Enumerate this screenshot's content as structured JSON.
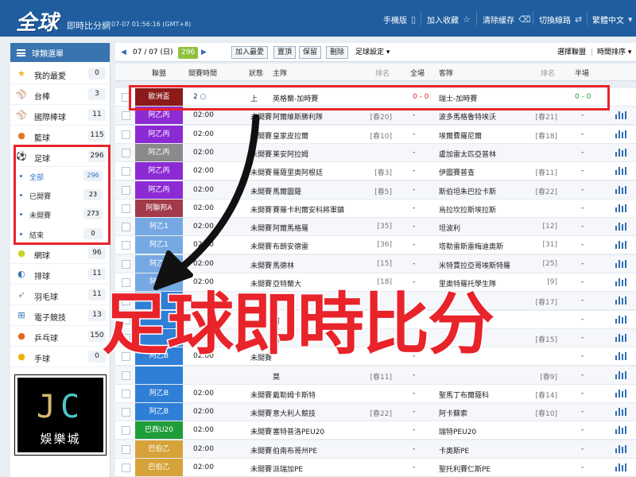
{
  "header": {
    "logo": "全球",
    "subtitle": "即時比分網",
    "clock": "07-07 01:56:16 (GMT+8)",
    "nav": {
      "mobile": "手機版",
      "bookmark": "加入收藏",
      "clear_cache": "清除緩存",
      "switch_line": "切換線路",
      "language": "繁體中文"
    }
  },
  "sidebar": {
    "title": "球類選單",
    "items": [
      {
        "label": "我的最愛",
        "count": "0",
        "icon": "star-icon"
      },
      {
        "label": "台棒",
        "count": "3",
        "icon": "baseball-icon"
      },
      {
        "label": "國際棒球",
        "count": "11",
        "icon": "baseball-icon"
      },
      {
        "label": "籃球",
        "count": "115",
        "icon": "basketball-icon"
      },
      {
        "label": "足球",
        "count": "296",
        "icon": "soccer-icon"
      },
      {
        "label": "網球",
        "count": "96",
        "icon": "tennis-icon"
      },
      {
        "label": "排球",
        "count": "11",
        "icon": "volleyball-icon"
      },
      {
        "label": "羽毛球",
        "count": "11",
        "icon": "badminton-icon"
      },
      {
        "label": "電子競技",
        "count": "13",
        "icon": "gamepad-icon"
      },
      {
        "label": "乒乓球",
        "count": "150",
        "icon": "pingpong-icon"
      },
      {
        "label": "手球",
        "count": "0",
        "icon": "handball-icon"
      }
    ],
    "soccer_sub": [
      {
        "label": "全部",
        "count": "296"
      },
      {
        "label": "已開賽",
        "count": "23"
      },
      {
        "label": "未開賽",
        "count": "273"
      },
      {
        "label": "結束",
        "count": "0"
      }
    ]
  },
  "toolbar": {
    "date": "07 / 07 (日)",
    "count": "296",
    "add_fav": "加入最愛",
    "top": "置頂",
    "keep": "保留",
    "delete": "刪除",
    "settings": "足球設定",
    "select_league": "選擇聯盟",
    "time_sort": "時間排序"
  },
  "table": {
    "headers": {
      "league": "聯盟",
      "start_time": "開賽時間",
      "status": "狀態",
      "home": "主隊",
      "home_rank": "排名",
      "full": "全場",
      "away": "客隊",
      "away_rank": "排名",
      "half": "半場"
    },
    "rows": [
      {
        "league": "歐洲盃",
        "color": "#8b1a1a",
        "time": "2",
        "state": "上",
        "home": "英格蘭-加時賽",
        "hrank": "",
        "full": "0 - 0",
        "away": "瑞士-加時賽",
        "arank": "",
        "half": "0 - 0",
        "live": true
      },
      {
        "league": "阿乙丙",
        "color": "#8c2bd4",
        "time": "02:00",
        "state": "未開賽",
        "home": "阿爾維斯勝利隊",
        "hrank": "[春20]",
        "full": "-",
        "away": "波多馬格魯特埃沃",
        "arank": "[春21]",
        "half": "-"
      },
      {
        "league": "阿乙丙",
        "color": "#8c2bd4",
        "time": "02:00",
        "state": "未開賽",
        "home": "皇家皮拉爾",
        "hrank": "[春10]",
        "full": "-",
        "away": "埃爾費羅尼爾",
        "arank": "[春18]",
        "half": "-"
      },
      {
        "league": "阿乙丙",
        "color": "#8a8a8a",
        "time": "02:00",
        "state": "未開賽",
        "home": "莱安阿拉姆",
        "hrank": "",
        "full": "-",
        "away": "盧加雷太匹亞普林",
        "arank": "",
        "half": "-"
      },
      {
        "league": "阿乙丙",
        "color": "#8c2bd4",
        "time": "02:00",
        "state": "未開賽",
        "home": "羅薩里奧阿根廷",
        "hrank": "[春3]",
        "full": "-",
        "away": "伊圖賽普查",
        "arank": "[春11]",
        "half": "-"
      },
      {
        "league": "阿乙丙",
        "color": "#8c2bd4",
        "time": "02:00",
        "state": "未開賽",
        "home": "馬爾圖薩",
        "hrank": "[春5]",
        "full": "-",
        "away": "斯伯坦朱巴拉卡斯",
        "arank": "[春22]",
        "half": "-"
      },
      {
        "league": "阿聯邦A",
        "color": "#a33a4a",
        "time": "02:00",
        "state": "未開賽",
        "home": "賽羅卡利爾安科將軍鎮",
        "hrank": "",
        "full": "-",
        "away": "烏拉坎拉斯埃拉斯",
        "arank": "",
        "half": "-"
      },
      {
        "league": "阿乙1",
        "color": "#76a9e3",
        "time": "02:00",
        "state": "未開賽",
        "home": "阿爾馬格羅",
        "hrank": "[35]",
        "full": "-",
        "away": "坦波利",
        "arank": "[12]",
        "half": "-"
      },
      {
        "league": "阿乙1",
        "color": "#76a9e3",
        "time": "02:00",
        "state": "未開賽",
        "home": "布朗安德雷",
        "hrank": "[36]",
        "full": "-",
        "away": "塔勒雷斯雷梅迪奧斯",
        "arank": "[31]",
        "half": "-"
      },
      {
        "league": "阿乙1",
        "color": "#76a9e3",
        "time": "02:00",
        "state": "未開賽",
        "home": "馬德林",
        "hrank": "[15]",
        "full": "-",
        "away": "米特賈拉亞哥埃斯特羅",
        "arank": "[25]",
        "half": "-"
      },
      {
        "league": "阿乙1",
        "color": "#76a9e3",
        "time": "02:00",
        "state": "未開賽",
        "home": "亞特蘭大",
        "hrank": "[18]",
        "full": "-",
        "away": "里奧特羅托學生隊",
        "arank": "[9]",
        "half": "-"
      },
      {
        "league": "",
        "color": "#2f7fd6",
        "time": "",
        "state": "",
        "home": "",
        "hrank": "",
        "full": "",
        "away": "",
        "arank": "[春17]",
        "half": "-"
      },
      {
        "league": "",
        "color": "#2f7fd6",
        "time": "",
        "state": "",
        "home": "阿",
        "hrank": "",
        "full": "",
        "away": "",
        "arank": "",
        "half": "-"
      },
      {
        "league": "",
        "color": "#2f7fd6",
        "time": "",
        "state": "",
        "home": "阿",
        "hrank": "",
        "full": "",
        "away": "",
        "arank": "[春15]",
        "half": "-"
      },
      {
        "league": "阿乙B",
        "color": "#2f7fd6",
        "time": "02:00",
        "state": "未開賽",
        "home": "",
        "hrank": "",
        "full": "-",
        "away": "",
        "arank": "",
        "half": "-"
      },
      {
        "league": "",
        "color": "#2f7fd6",
        "time": "",
        "state": "",
        "home": "莫",
        "hrank": "[春11]",
        "full": "-",
        "away": "",
        "arank": "[春9]",
        "half": "-"
      },
      {
        "league": "阿乙B",
        "color": "#2f7fd6",
        "time": "02:00",
        "state": "未開賽",
        "home": "戴勒姆卡斯特",
        "hrank": "",
        "full": "-",
        "away": "聖馬丁布爾薩科",
        "arank": "[春14]",
        "half": "-"
      },
      {
        "league": "阿乙B",
        "color": "#2f7fd6",
        "time": "02:00",
        "state": "未開賽",
        "home": "意大利人競技",
        "hrank": "[春22]",
        "full": "-",
        "away": "阿卡蘇索",
        "arank": "[春10]",
        "half": "-"
      },
      {
        "league": "巴西U20",
        "color": "#1f9d3a",
        "time": "02:00",
        "state": "未開賽",
        "home": "塞特普洛PEU20",
        "hrank": "",
        "full": "-",
        "away": "瑞特PEU20",
        "arank": "",
        "half": "-"
      },
      {
        "league": "巴伯乙",
        "color": "#d6a33a",
        "time": "02:00",
        "state": "未開賽",
        "home": "伯南布哥州PE",
        "hrank": "",
        "full": "-",
        "away": "卡奧斯PE",
        "arank": "",
        "half": "-"
      },
      {
        "league": "巴伯乙",
        "color": "#d6a33a",
        "time": "02:00",
        "state": "未開賽",
        "home": "派瑞加PE",
        "hrank": "",
        "full": "-",
        "away": "聖托利賽仁斯PE",
        "arank": "",
        "half": "-"
      }
    ]
  },
  "overlay": {
    "headline": "足球即時比分"
  },
  "badge": {
    "j": "J",
    "c": "C",
    "name": "娛樂城"
  },
  "colors": {
    "header_bg": "#1f5d9f",
    "accent_red": "#e8232a",
    "count_green": "#8fc13e"
  }
}
